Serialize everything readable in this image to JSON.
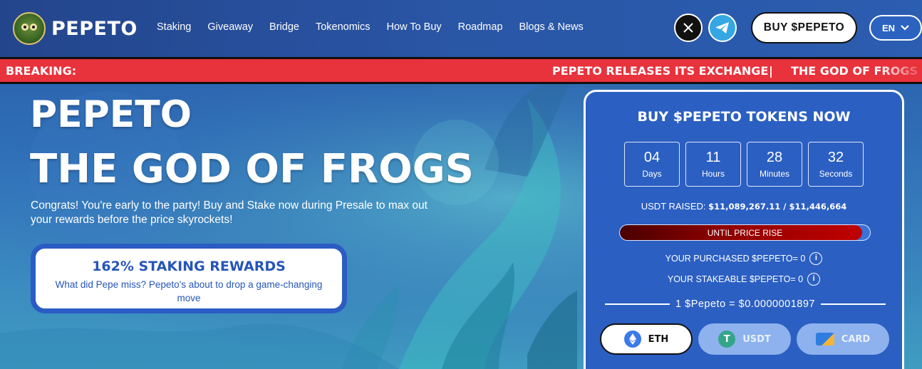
{
  "brand": {
    "name": "PEPETO"
  },
  "nav": {
    "items": [
      "Staking",
      "Giveaway",
      "Bridge",
      "Tokenomics",
      "How To Buy",
      "Roadmap",
      "Blogs & News"
    ],
    "buy_label": "BUY $PEPETO",
    "lang": "EN",
    "social": [
      "x-icon",
      "telegram-icon"
    ]
  },
  "ticker": {
    "label": "BREAKING:",
    "item1": "PEPETO RELEASES ITS EXCHANGE",
    "sep": "|",
    "item2": "THE GOD OF FROGS IS"
  },
  "hero": {
    "title1": "PEPETO",
    "title2": "THE GOD OF FROGS",
    "description": "Congrats! You're early to the party! Buy and Stake now during Presale to max out your rewards before the price skyrockets!",
    "card_title": "162% STAKING REWARDS",
    "card_text": "What did Pepe miss? Pepeto's about to drop a game-changing move"
  },
  "presale": {
    "title": "BUY $PEPETO TOKENS NOW",
    "countdown": [
      {
        "value": "04",
        "label": "Days"
      },
      {
        "value": "11",
        "label": "Hours"
      },
      {
        "value": "28",
        "label": "Minutes"
      },
      {
        "value": "32",
        "label": "Seconds"
      }
    ],
    "raised_label": "USDT RAISED:",
    "raised_value": "$11,089,267.11 / $11,446,664",
    "progress_fraction": 0.969,
    "progress_label": "UNTIL PRICE RISE",
    "purchased": "YOUR PURCHASED $PEPETO= 0",
    "stakeable": "YOUR STAKEABLE $PEPETO= 0",
    "price": "1 $Pepeto = $0.0000001897",
    "pay": {
      "eth": "ETH",
      "usdt": "USDT",
      "card": "CARD"
    }
  },
  "colors": {
    "accent": "#2b5fc2",
    "ticker": "#e8323c",
    "progress": "#8a0000"
  }
}
